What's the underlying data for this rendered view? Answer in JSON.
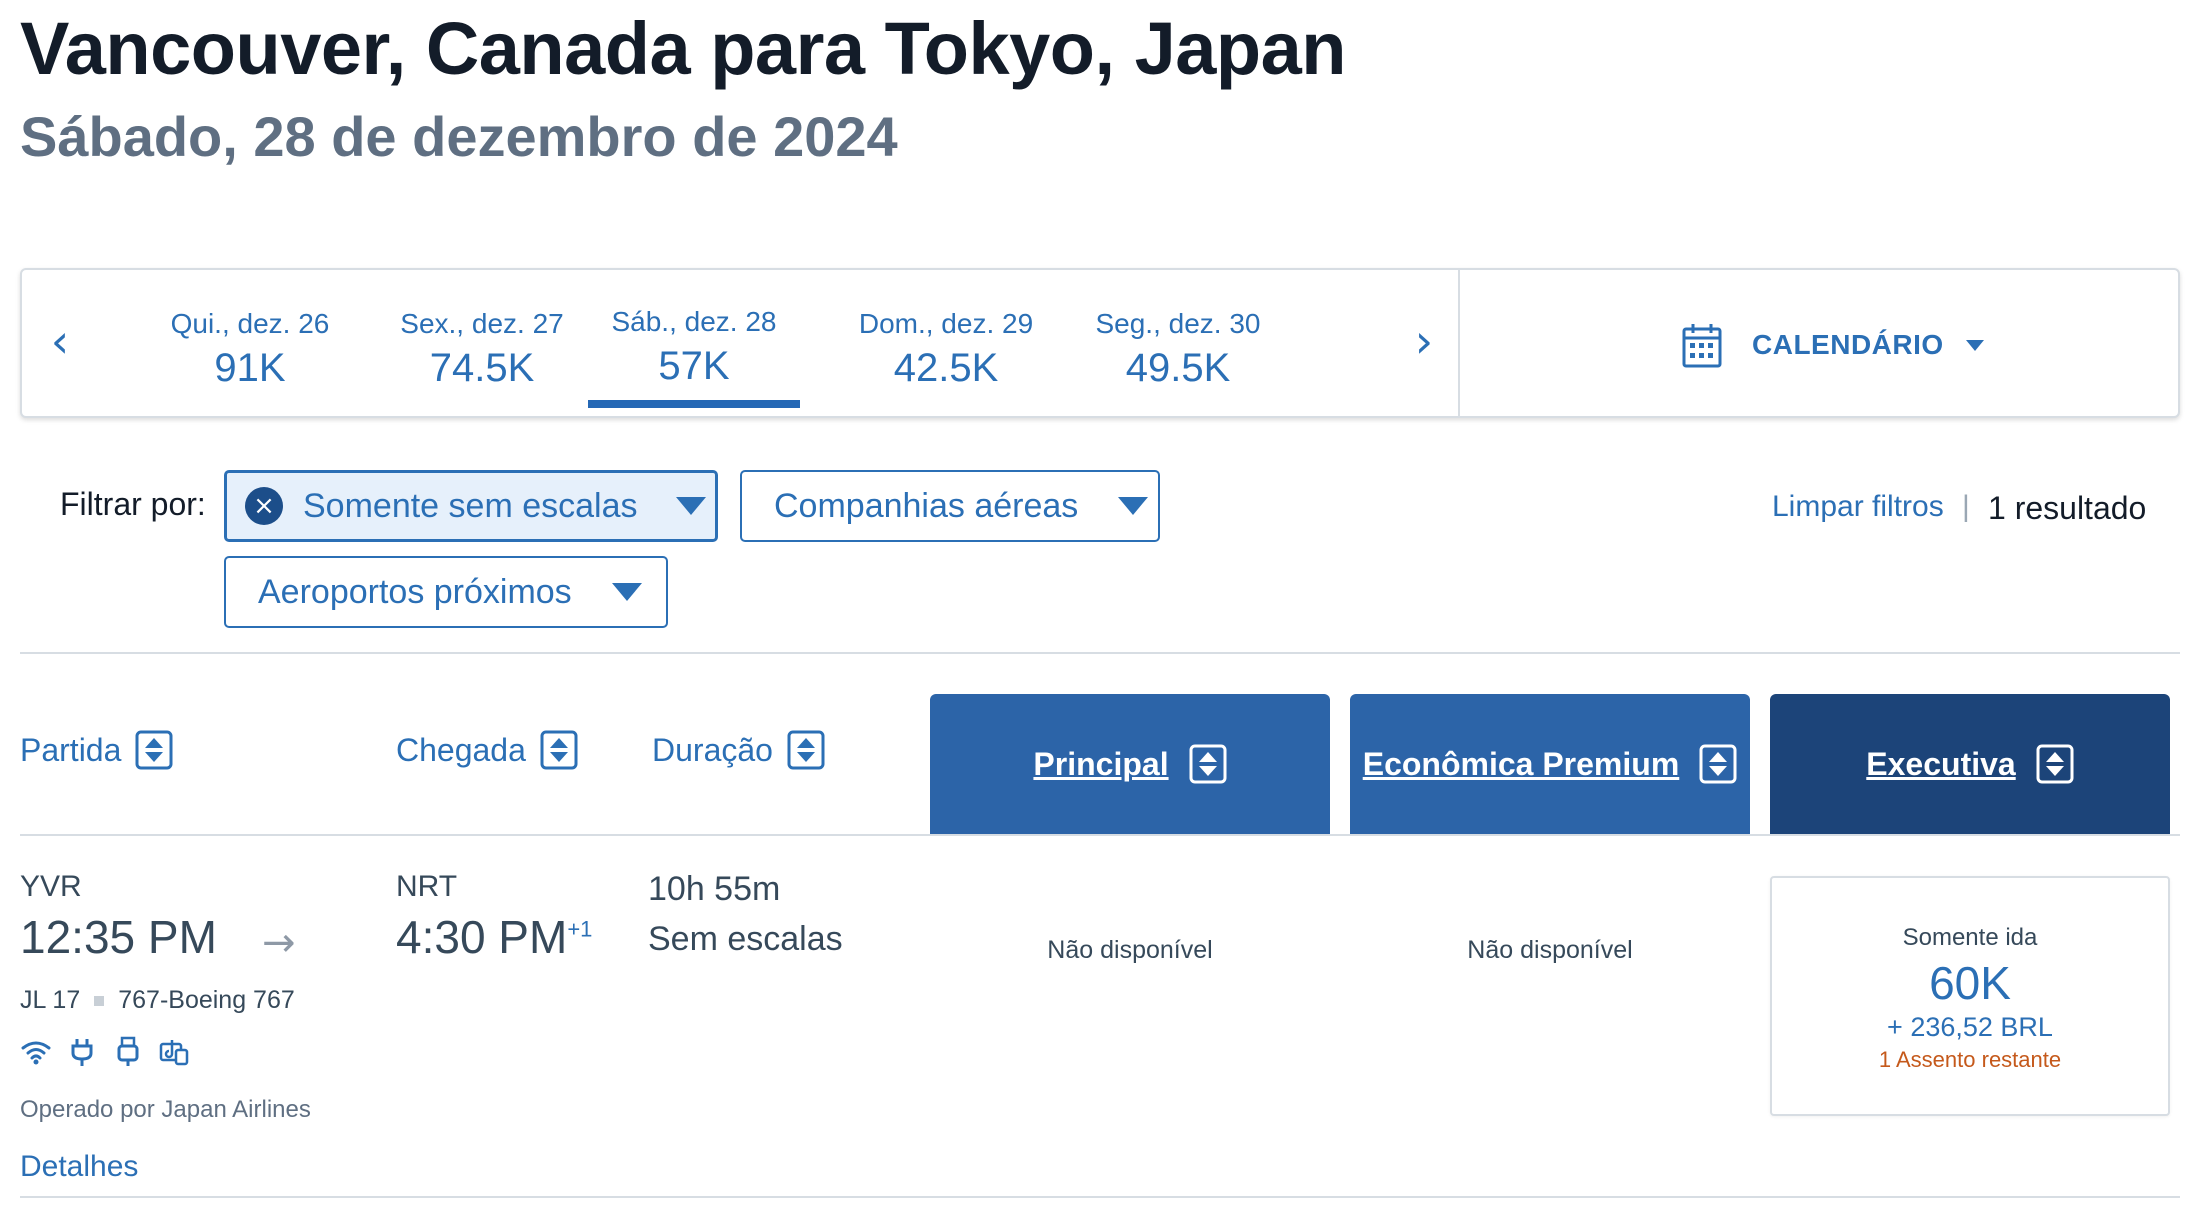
{
  "header": {
    "route": "Vancouver, Canada para Tokyo, Japan",
    "date": "Sábado, 28 de dezembro de 2024"
  },
  "date_strip": {
    "prev_icon": "chevron-left-icon",
    "next_icon": "chevron-right-icon",
    "prev_glyph": "‹",
    "next_glyph": "›",
    "dates": [
      {
        "label": "Qui., dez. 26",
        "price": "91K"
      },
      {
        "label": "Sex., dez. 27",
        "price": "74.5K"
      },
      {
        "label": "Sáb., dez. 28",
        "price": "57K",
        "selected": true
      },
      {
        "label": "Dom., dez. 29",
        "price": "42.5K"
      },
      {
        "label": "Seg., dez. 30",
        "price": "49.5K"
      }
    ],
    "calendar_label": "CALENDÁRIO"
  },
  "filters": {
    "label": "Filtrar por:",
    "nonstop": "Somente sem escalas",
    "nonstop_clear_glyph": "×",
    "airlines": "Companhias aéreas",
    "nearby_airports": "Aeroportos próximos",
    "clear": "Limpar filtros",
    "separator": "|",
    "result_count": "1 resultado"
  },
  "columns": {
    "departure": "Partida",
    "arrival": "Chegada",
    "duration": "Duração",
    "cabins": [
      "Principal",
      "Econômica Premium",
      "Executiva"
    ]
  },
  "flight": {
    "origin": "YVR",
    "departure_time": "12:35 PM",
    "arrow_glyph": "→",
    "destination": "NRT",
    "arrival_time": "4:30 PM",
    "day_offset": "+1",
    "duration": "10h 55m",
    "stops": "Sem escalas",
    "flight_number": "JL 17",
    "aircraft": "767-Boeing 767",
    "amenities": [
      "wifi-icon",
      "power-outlet-icon",
      "usb-icon",
      "entertainment-icon"
    ],
    "operated_by": "Operado por Japan Airlines",
    "details": "Detalhes",
    "fares": {
      "main": "Não disponível",
      "premium": "Não disponível",
      "business": {
        "type": "Somente ida",
        "miles": "60K",
        "taxes": "+ 236,52 BRL",
        "seats": "1 Assento restante"
      }
    }
  },
  "colors": {
    "link_blue": "#2b6fb5",
    "cabin_main": "#2c64a8",
    "cabin_premium": "#2c64a8",
    "cabin_business": "#1c4479",
    "seats_warning": "#c5591b"
  }
}
